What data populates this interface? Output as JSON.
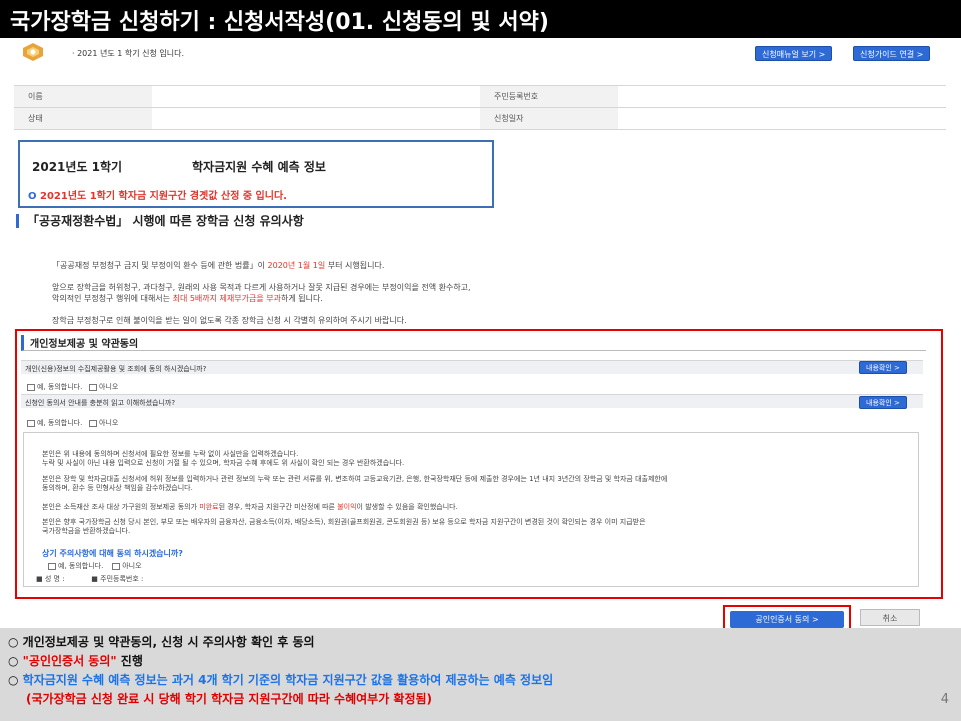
{
  "header": {
    "title": "국가장학금 신청하기 : 신청서작성(01. 신청동의 및 서약)"
  },
  "topbar": {
    "semester_text": "· 2021 년도 1 학기 신청 입니다.",
    "manual_button": "신청매뉴얼 보기 >",
    "guide_button": "신청가이드 연결 >"
  },
  "info": {
    "name_label": "이름",
    "rrn_label": "주민등록번호",
    "status_label": "상태",
    "date_label": "신청일자"
  },
  "predict": {
    "semester": "2021년도 1학기",
    "title": "학자금지원 수혜 예측 정보",
    "bullet": "O",
    "note": "2021년도 1학기 학자금 지원구간 경곗값 산정 중 입니다."
  },
  "notice": {
    "heading": "「공공재정환수법」 시행에 따른 장학금 신청 유의사항",
    "p1a": "「공공재정 부정청구 금지 및 부정이익 환수 등에 관한 법률」이 ",
    "p1b": "2020년 1월 1일",
    "p1c": " 부터 시행됩니다.",
    "p2": "앞으로 장학금을 허위청구, 과다청구, 원래의 사용 목적과 다르게 사용하거나 잘못 지급된 경우에는 부정이익을 전액 환수하고,",
    "p3a": "악의적인 부정청구 행위에 대해서는 ",
    "p3b": "최대 5배까지 제재부가금을 부과",
    "p3c": "하게 됩니다.",
    "p4": "장학금 부정청구로 인해 불이익을 받는 일이 없도록 각종 장학금 신청 시 각별히 유의하여 주시기 바랍니다."
  },
  "consent": {
    "heading": "개인정보제공 및 약관동의",
    "q1": "개인(신용)정보의 수집제공활용 및 조회에 동의 하시겠습니까?",
    "q2": "신청인 동의서 안내를 충분히 읽고 이해하셨습니까?",
    "view_button": "내용확인 >",
    "agree": "예, 동의합니다.",
    "disagree": "아니오",
    "q2_agree": "예, 동의합니다.",
    "t1a": "본인은 위 내용에 동의하며 신청서에 필요한 정보를 누락 없이 사실만을 입력하겠습니다.",
    "t1b": "누락 및 사실이 아닌 내용 입력으로 신청이 거절 될 수 있으며, 학자금 수혜 후에도 위 사실이 확인 되는 경우 반환하겠습니다.",
    "t2a": "본인은 장학 및 학자금대출 신청서에 허위 정보를 입력하거나 관련 정보의 누락 또는 관련 서류를 위, 변조하여 고등교육기관, 은행, 한국장학재단 등에 제출한 경우에는 1년 내지 3년간의 장학금 및 학자금 대출제한에",
    "t2b": "동의하며, 환수 등 민형사상 책임을 감수하겠습니다.",
    "t3a": "본인은 소득재산 조사 대상 가구원의 정보제공 동의가 ",
    "t3b": "미완료",
    "t3c": "된 경우, 학자금 지원구간 미산정에 따른 ",
    "t3d": "불이익",
    "t3e": "이 발생할 수 있음을 확인했습니다.",
    "t4a": "본인은 향후 국가장학금 신청 당시 본인, 부모 또는 배우자의 금융자산, 금융소득(이자, 배당소득), 회원권(골프회원권, 콘도회원권 등) 보유 등으로 학자금 지원구간이 변경된 것이 확인되는 경우 이미 지급받은",
    "t4b": "국가장학금을 반환하겠습니다.",
    "final_q": "상기 주의사항에 대해 동의 하시겠습니까?",
    "final_agree": "예, 동의합니다.",
    "final_disagree": "아니오",
    "sign_name": "성 명 :",
    "sign_rrn": "주민등록번호 :",
    "sign_bullet": "■"
  },
  "actions": {
    "cert_button": "공인인증서 동의  >",
    "cancel_button": "취소"
  },
  "bottom": {
    "line1": "○ 개인정보제공 및 약관동의, 신청 시 주의사항 확인 후 동의",
    "line2_prefix": "○ ",
    "line2_red": "\"공인인증서 동의\"",
    "line2_suffix": " 진행",
    "line3_prefix": "○ ",
    "line3_blue": "학자금지원 수혜 예측 정보는 과거 4개 학기 기준의 학자금 지원구간 값을 활용하여 제공하는 예측 정보임",
    "line4_red": "(국가장학금 신청 완료 시 당해 학기 학자금 지원구간에 따라 수혜여부가 확정됨)",
    "page_number": "4"
  }
}
